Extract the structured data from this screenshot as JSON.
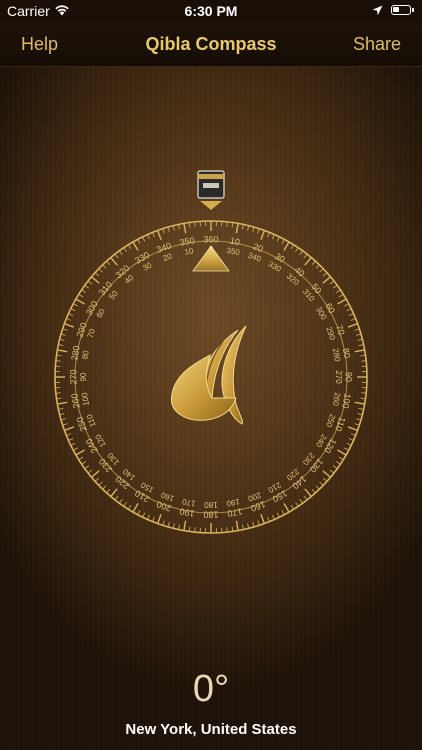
{
  "status_bar": {
    "carrier": "Carrier",
    "time": "6:30 PM"
  },
  "nav": {
    "left_label": "Help",
    "title": "Qibla Compass",
    "right_label": "Share"
  },
  "compass": {
    "heading": "0°",
    "outer_labels": [
      "360",
      "10",
      "20",
      "30",
      "40",
      "50",
      "60",
      "70",
      "80",
      "90",
      "100",
      "110",
      "120",
      "130",
      "140",
      "150",
      "160",
      "170",
      "180",
      "190",
      "200",
      "210",
      "220",
      "230",
      "240",
      "250",
      "260",
      "270",
      "280",
      "290",
      "300",
      "310",
      "320",
      "330",
      "340",
      "350"
    ],
    "inner_labels": [
      "0",
      "350",
      "340",
      "330",
      "320",
      "310",
      "300",
      "290",
      "280",
      "270",
      "260",
      "250",
      "240",
      "230",
      "220",
      "210",
      "200",
      "190",
      "180",
      "170",
      "160",
      "150",
      "140",
      "130",
      "120",
      "110",
      "100",
      "90",
      "80",
      "70",
      "60",
      "50",
      "40",
      "30",
      "20",
      "10"
    ],
    "kaaba_icon": "kaaba-icon",
    "pointer_icon": "triangle-pointer-icon",
    "emblem_icon": "qibla-emblem-icon"
  },
  "location": "New York, United States",
  "colors": {
    "gold": "#e0bb62",
    "dial_gold": "#d8b460",
    "background": "#563819"
  }
}
